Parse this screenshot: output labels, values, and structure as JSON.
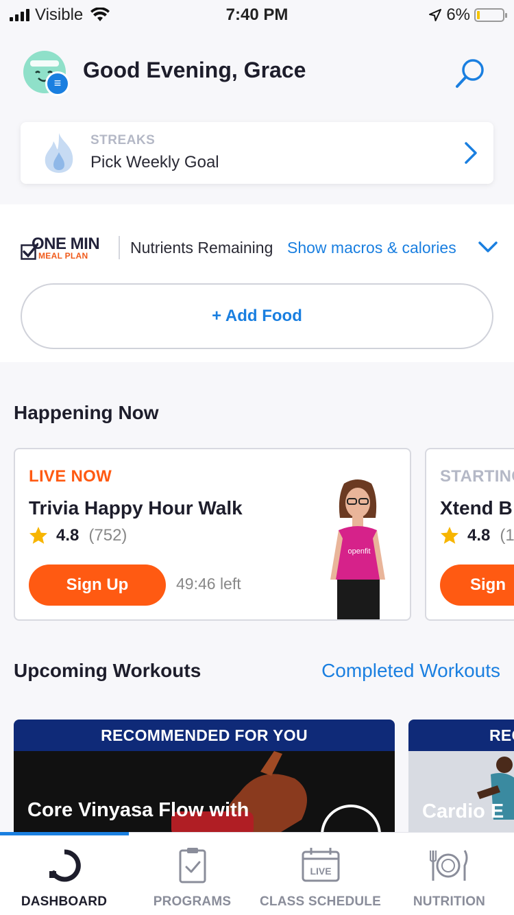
{
  "status_bar": {
    "carrier": "Visible",
    "time": "7:40 PM",
    "battery": "6%",
    "icons": [
      "signal-icon",
      "wifi-icon",
      "location-arrow-icon",
      "battery-icon"
    ]
  },
  "header": {
    "greeting": "Good Evening, Grace",
    "icons": [
      "avatar-icon",
      "menu-icon",
      "search-icon"
    ]
  },
  "streaks": {
    "label": "STREAKS",
    "goal": "Pick Weekly Goal",
    "icons": [
      "flame-icon",
      "chevron-right-icon"
    ]
  },
  "meal_plan": {
    "logo_top": "ONE MIN",
    "logo_bottom": "MEAL PLAN",
    "nutrients_label": "Nutrients Remaining",
    "show_macros": "Show macros & calories",
    "add_food": "+ Add Food"
  },
  "happening_now": {
    "title": "Happening Now",
    "cards": [
      {
        "status": "LIVE NOW",
        "status_color": "#ff5a12",
        "title": "Trivia Happy Hour Walk",
        "rating": "4.8",
        "count": "(752)",
        "button": "Sign Up",
        "time_left": "49:46 left",
        "shirt_text": "openfit"
      },
      {
        "status": "STARTING",
        "status_color": "#b4b8c6",
        "title": "Xtend B",
        "rating": "4.8",
        "count": "(1",
        "button": "Sign"
      }
    ]
  },
  "upcoming": {
    "title": "Upcoming Workouts",
    "completed_link": "Completed Workouts",
    "cards": [
      {
        "band": "RECOMMENDED FOR YOU",
        "title": "Core Vinyasa Flow with"
      },
      {
        "band": "REC",
        "title": "Cardio E"
      }
    ]
  },
  "tabbar": {
    "tabs": [
      {
        "label": "DASHBOARD",
        "icon": "dashboard-icon",
        "active": true
      },
      {
        "label": "PROGRAMS",
        "icon": "clipboard-icon",
        "active": false
      },
      {
        "label": "CLASS SCHEDULE",
        "icon": "calendar-live-icon",
        "badge": "LIVE",
        "active": false
      },
      {
        "label": "NUTRITION",
        "icon": "plate-utensils-icon",
        "active": false
      }
    ]
  },
  "colors": {
    "accent_blue": "#1a7fe0",
    "live_orange": "#ff5a12",
    "band_navy": "#0f2a78"
  }
}
